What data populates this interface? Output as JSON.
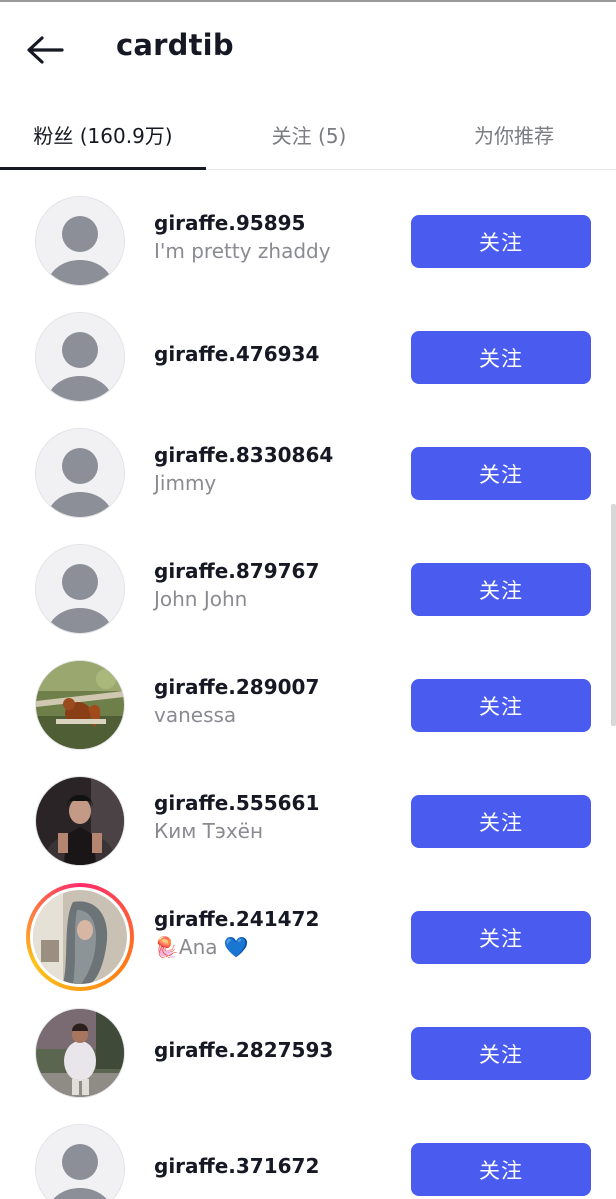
{
  "header": {
    "title": "cardtib",
    "back_icon": "arrow-left-icon"
  },
  "tabs": [
    {
      "label": "粉丝 (160.9万)",
      "active": true
    },
    {
      "label": "关注 (5)",
      "active": false
    },
    {
      "label": "为你推荐",
      "active": false
    }
  ],
  "followers": [
    {
      "username": "giraffe.95895",
      "nickname": "I'm pretty zhaddy",
      "avatar": "default-avatar-icon",
      "button": "关注"
    },
    {
      "username": "giraffe.476934",
      "nickname": "",
      "avatar": "default-avatar-icon",
      "button": "关注"
    },
    {
      "username": "giraffe.8330864",
      "nickname": "Jimmy",
      "avatar": "default-avatar-icon",
      "button": "关注"
    },
    {
      "username": "giraffe.879767",
      "nickname": "John John",
      "avatar": "default-avatar-icon",
      "button": "关注"
    },
    {
      "username": "giraffe.289007",
      "nickname": "vanessa",
      "avatar": "squirrel-photo",
      "button": "关注"
    },
    {
      "username": "giraffe.555661",
      "nickname": "Ким Тэхён",
      "avatar": "dark-portrait-photo",
      "button": "关注"
    },
    {
      "username": "giraffe.241472",
      "nickname": "🪼Ana 💙",
      "avatar": "gray-hair-photo-story-ring",
      "button": "关注"
    },
    {
      "username": "giraffe.2827593",
      "nickname": "",
      "avatar": "outdoor-person-photo",
      "button": "关注"
    },
    {
      "username": "giraffe.371672",
      "nickname": "",
      "avatar": "default-avatar-icon",
      "button": "关注"
    }
  ],
  "colors": {
    "button": "#4a5bf0",
    "text": "#161823",
    "muted": "#8a8b91"
  }
}
